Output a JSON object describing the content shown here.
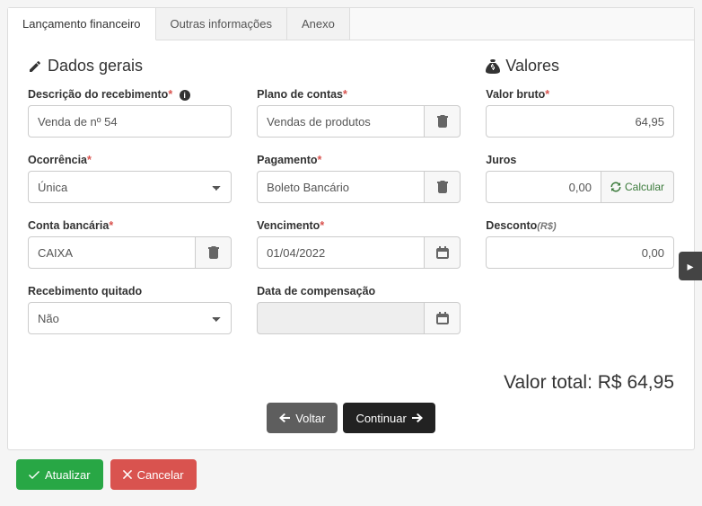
{
  "tabs": [
    "Lançamento financeiro",
    "Outras informações",
    "Anexo"
  ],
  "sections": {
    "dados_gerais": "Dados gerais",
    "valores": "Valores"
  },
  "labels": {
    "descricao": "Descrição do recebimento",
    "plano": "Plano de contas",
    "ocorrencia": "Ocorrência",
    "pagamento": "Pagamento",
    "conta": "Conta bancária",
    "vencimento": "Vencimento",
    "quitado": "Recebimento quitado",
    "compensacao": "Data de compensação",
    "valor_bruto": "Valor bruto",
    "juros": "Juros",
    "desconto": "Desconto",
    "desconto_unit": "(R$)"
  },
  "values": {
    "descricao": "Venda de nº 54",
    "plano": "Vendas de produtos",
    "ocorrencia": "Única",
    "pagamento": "Boleto Bancário",
    "conta": "CAIXA",
    "vencimento": "01/04/2022",
    "quitado": "Não",
    "compensacao": "",
    "valor_bruto": "64,95",
    "juros": "0,00",
    "desconto": "0,00"
  },
  "total": {
    "label": "Valor total:",
    "value": "R$ 64,95"
  },
  "buttons": {
    "calcular": "Calcular",
    "voltar": "Voltar",
    "continuar": "Continuar",
    "atualizar": "Atualizar",
    "cancelar": "Cancelar"
  }
}
